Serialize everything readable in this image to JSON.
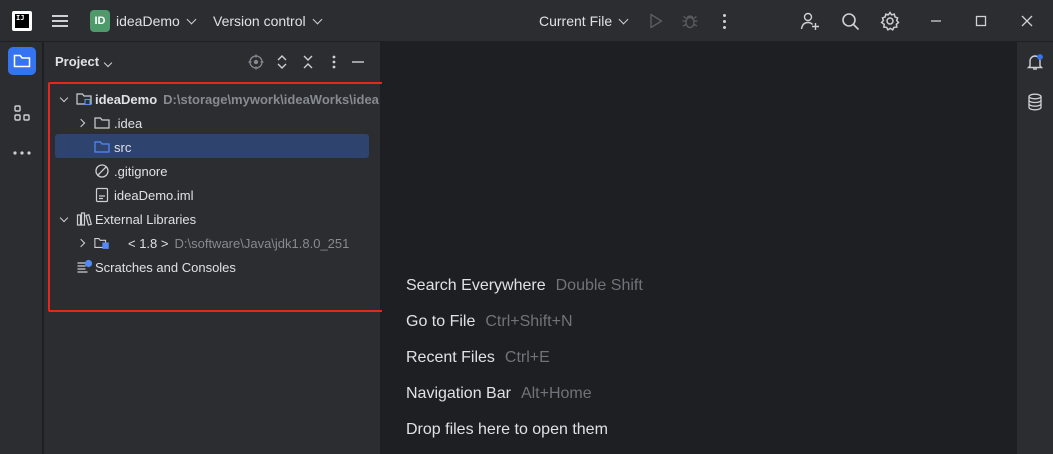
{
  "titlebar": {
    "logo_text": "IJ",
    "project_badge": "ID",
    "project_name": "ideaDemo",
    "vcs_label": "Version control",
    "run_config": "Current File"
  },
  "project_panel": {
    "title": "Project",
    "tree": [
      {
        "label": "ideaDemo",
        "path": "D:\\storage\\mywork\\ideaWorks\\idea",
        "icon": "module-folder-icon",
        "expanded": true
      },
      {
        "label": ".idea",
        "icon": "folder-icon",
        "expanded": false
      },
      {
        "label": "src",
        "icon": "folder-icon",
        "selected": true
      },
      {
        "label": ".gitignore",
        "icon": "ignored-file-icon"
      },
      {
        "label": "ideaDemo.iml",
        "icon": "iml-file-icon"
      },
      {
        "label": "External Libraries",
        "icon": "libraries-icon",
        "expanded": true
      },
      {
        "label": "< 1.8 >",
        "path": "D:\\software\\Java\\jdk1.8.0_251",
        "icon": "jdk-folder-icon",
        "expanded": false
      },
      {
        "label": "Scratches and Consoles",
        "icon": "scratches-icon"
      }
    ]
  },
  "editor": {
    "hints": [
      {
        "action": "Search Everywhere",
        "shortcut": "Double Shift"
      },
      {
        "action": "Go to File",
        "shortcut": "Ctrl+Shift+N"
      },
      {
        "action": "Recent Files",
        "shortcut": "Ctrl+E"
      },
      {
        "action": "Navigation Bar",
        "shortcut": "Alt+Home"
      },
      {
        "action": "Drop files here to open them",
        "shortcut": ""
      }
    ]
  },
  "colors": {
    "accent": "#3574f0",
    "selection": "#2e436e",
    "highlight_box": "#e5281f",
    "badge": "#4e9a6a"
  }
}
